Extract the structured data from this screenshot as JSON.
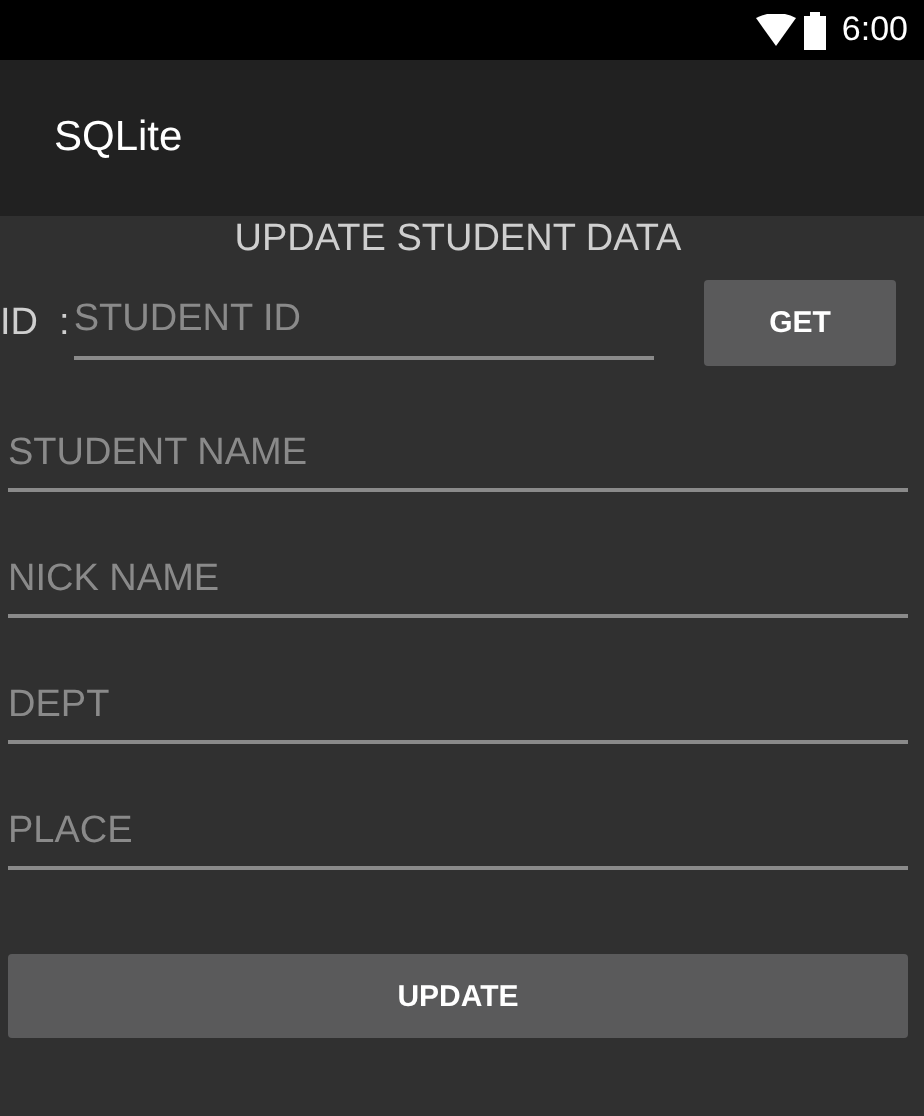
{
  "status_bar": {
    "time": "6:00"
  },
  "app_bar": {
    "title": "SQLite"
  },
  "heading": "UPDATE STUDENT DATA",
  "id_row": {
    "label": "ID  :",
    "placeholder": "STUDENT ID",
    "button": "GET"
  },
  "fields": [
    {
      "placeholder": "STUDENT NAME"
    },
    {
      "placeholder": "NICK NAME"
    },
    {
      "placeholder": "DEPT"
    },
    {
      "placeholder": "PLACE"
    }
  ],
  "submit": "UPDATE"
}
